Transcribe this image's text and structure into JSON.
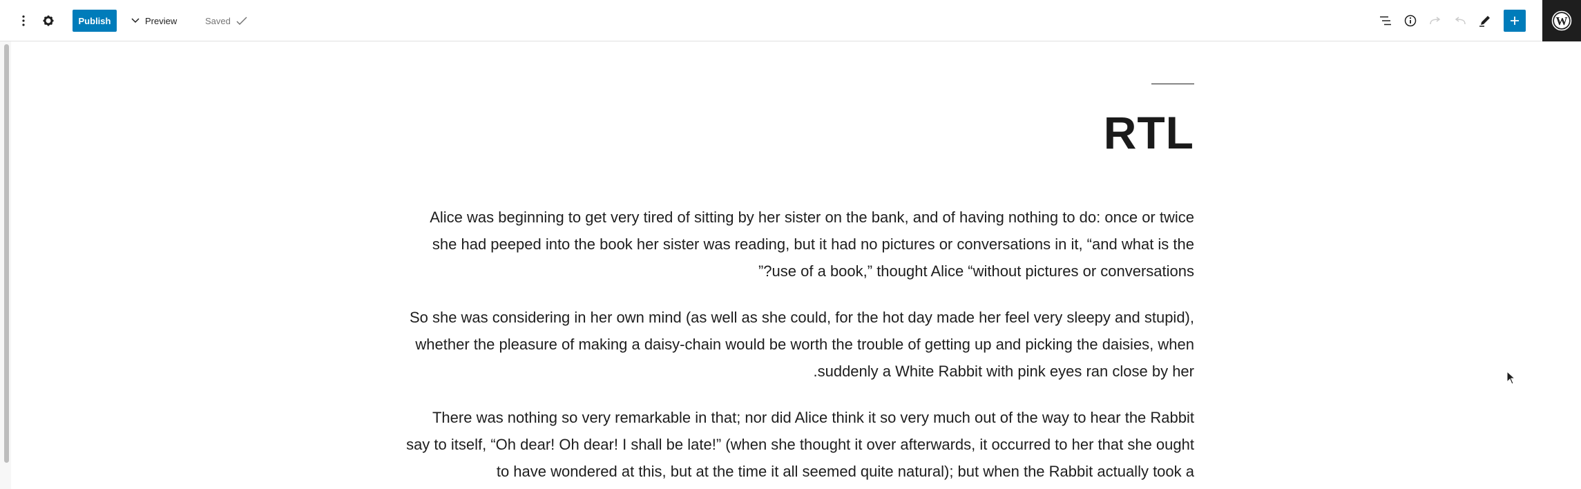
{
  "toolbar": {
    "options_icon": "kebab-icon",
    "settings_icon": "gear-icon",
    "publish_label": "Publish",
    "preview_label": "Preview",
    "saved_label": "Saved",
    "right_icons": [
      "list-view-icon",
      "info-icon",
      "redo-icon",
      "undo-icon",
      "edit-pen-icon",
      "add-block-icon"
    ],
    "logo": "wordpress-logo",
    "accent_color": "#007cba"
  },
  "post": {
    "title": "RTL",
    "paragraphs": [
      "Alice was beginning to get very tired of sitting by her sister on the bank, and of having nothing to do: once or twice she had peeped into the book her sister was reading, but it had no pictures or conversations in it, “and what is the use of a book,” thought Alice “without pictures or conversations?”",
      "So she was considering in her own mind (as well as she could, for the hot day made her feel very sleepy and stupid), whether the pleasure of making a daisy-chain would be worth the trouble of getting up and picking the daisies, when suddenly a White Rabbit with pink eyes ran close by her.",
      "There was nothing so very remarkable in that; nor did Alice think it so very much out of the way to hear the Rabbit say to itself, “Oh dear! Oh dear! I shall be late!” (when she thought it over afterwards, it occurred to her that she ought to have wondered at this, but at the time it all seemed quite natural); but when the Rabbit actually took a"
    ]
  }
}
